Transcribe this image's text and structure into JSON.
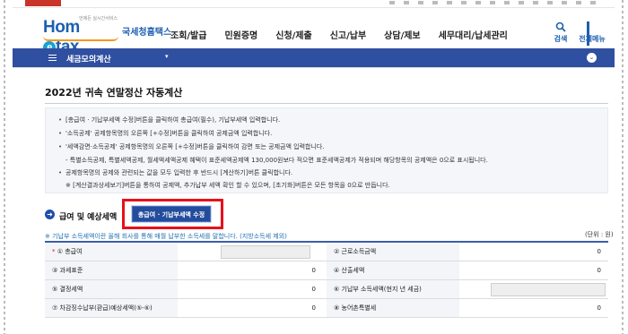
{
  "header": {
    "logo_text_a": "Hom",
    "logo_text_e": "e",
    "logo_text_b": "tax",
    "logo_tagline": "언제든 실시간서비스",
    "logo_korean": "국세청홈택스",
    "nav": [
      "조회/발급",
      "민원증명",
      "신청/제출",
      "신고/납부",
      "상담/제보",
      "세무대리/납세관리"
    ],
    "search_label": "검색",
    "allmenu_label": "전체메뉴"
  },
  "menubar": {
    "title": "세금모의계산",
    "caret": "▾",
    "collapse": "⌄"
  },
  "page": {
    "title": "2022년 귀속 연말정산 자동계산"
  },
  "info": {
    "lines": [
      "[총급여 · 기납부세액 수정]버튼을 클릭하여 총급여(필수), 기납부세액 입력합니다.",
      "'소득공제' 공제항목명의 오른쪽 [+수정]버튼을 클릭하여 공제금액 입력합니다.",
      "'세액감면·소득공제' 공제항목명의 오른쪽 [+수정]버튼을 클릭하여 감면 또는 공제금액 입력합니다.",
      "- 특별소득공제, 특별세액공제, 월세액세액공제 혜택이 표준세액공제액 130,000원보다 적으면 표준세액공제가 적용되며 해당항목의 공제액은 0으로 표시됩니다.",
      "공제항목명의 공제와 관련되는 값을 모두 입력한 후 반드시 [계산하기]버튼 클릭합니다.",
      "※ [계산결과상세보기]버튼을 통하여 공제액, 추가납부 세액 확인 할 수 있으며, [초기화]버튼은 모든 항목을 0으로 만듭니다."
    ]
  },
  "section": {
    "icon": "➜",
    "title": "급여 및 예상세액",
    "edit_button": "총급여 · 기납부세액 수정",
    "note": "※ 기납부 소득세액이란 올해 회사를 통해 매월 납부한 소득세를 말합니다. (지방소득세 제외)",
    "unit": "(단위 : 원)"
  },
  "table": {
    "rows": [
      {
        "left_label": "① 총급여",
        "left_required": true,
        "left_value": "",
        "right_label": "② 근로소득금액",
        "right_value": "0"
      },
      {
        "left_label": "③ 과세표준",
        "left_required": false,
        "left_value": "0",
        "right_label": "④ 산출세액",
        "right_value": "0"
      },
      {
        "left_label": "⑤ 결정세액",
        "left_required": false,
        "left_value": "0",
        "right_label": "⑥ 기납부 소득세액(현지 년 세금)",
        "right_value": ""
      },
      {
        "left_label": "⑦ 차감징수납부(환급)예상세액(⑤-⑥)",
        "left_required": false,
        "left_value": "0",
        "right_label": "⑧ 농어촌특별세",
        "right_value": "0"
      }
    ]
  },
  "colors": {
    "brand_blue": "#1d5fb0",
    "menubar": "#2f4fa0",
    "highlight_red": "#e8101a",
    "button_blue": "#234c9c"
  }
}
